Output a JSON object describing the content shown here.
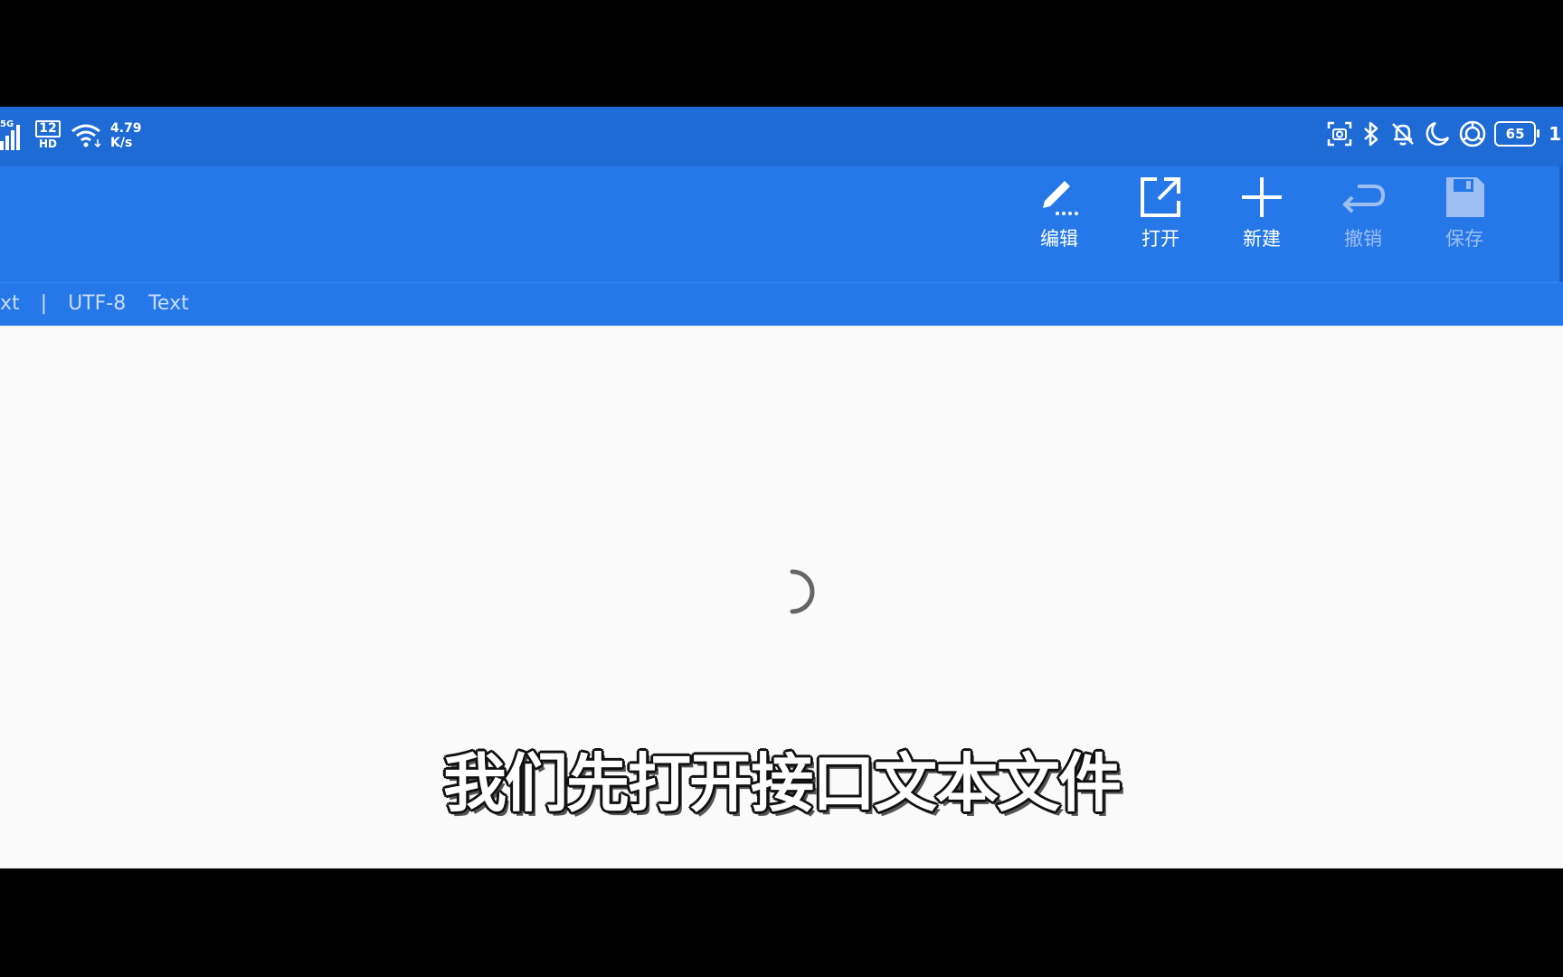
{
  "status_bar": {
    "network_type": "5G",
    "sim_label_top": "12",
    "sim_label_bottom": "HD",
    "speed_value": "4.79",
    "speed_unit": "K/s",
    "battery_level": "65",
    "clock_partial": "1"
  },
  "toolbar": {
    "buttons": [
      {
        "label": "编辑",
        "icon": "pencil-icon",
        "enabled": true
      },
      {
        "label": "打开",
        "icon": "open-external-icon",
        "enabled": true
      },
      {
        "label": "新建",
        "icon": "plus-icon",
        "enabled": true
      },
      {
        "label": "撤销",
        "icon": "undo-icon",
        "enabled": false
      },
      {
        "label": "保存",
        "icon": "save-icon",
        "enabled": false
      }
    ]
  },
  "infobar": {
    "file_type_partial": "xt",
    "separator": "|",
    "encoding": "UTF-8",
    "mode": "Text"
  },
  "subtitle": "我们先打开接口文本文件",
  "colors": {
    "status_bar": "#1f6bd6",
    "toolbar": "#2678e8",
    "content_bg": "#fafafa",
    "disabled_text": "#9dbef0"
  }
}
